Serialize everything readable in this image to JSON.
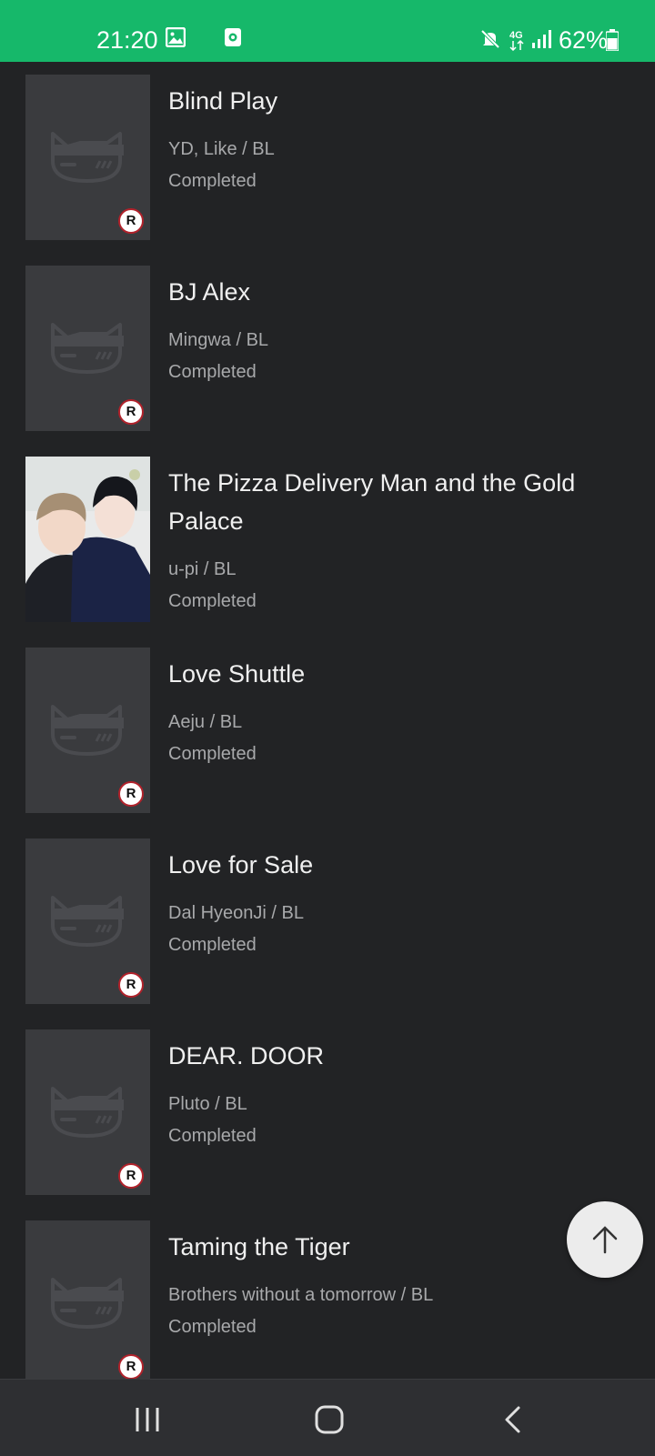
{
  "status_bar": {
    "time": "21:20",
    "battery_percent": "62%",
    "network": "4G",
    "icons": [
      "gallery-icon",
      "app-notification-icon",
      "mute-icon",
      "network-4g-icon",
      "signal-icon",
      "battery-icon"
    ]
  },
  "list": {
    "items": [
      {
        "title": "Blind Play",
        "author_genre": "YD, Like / BL",
        "status": "Completed",
        "cover": "placeholder",
        "rating_badge": "R"
      },
      {
        "title": "BJ Alex",
        "author_genre": "Mingwa / BL",
        "status": "Completed",
        "cover": "placeholder",
        "rating_badge": "R"
      },
      {
        "title": "The Pizza Delivery Man and the Gold Palace",
        "author_genre": "u-pi / BL",
        "status": "Completed",
        "cover": "artwork"
      },
      {
        "title": "Love Shuttle",
        "author_genre": "Aeju / BL",
        "status": "Completed",
        "cover": "placeholder",
        "rating_badge": "R"
      },
      {
        "title": "Love for Sale",
        "author_genre": "Dal HyeonJi / BL",
        "status": "Completed",
        "cover": "placeholder",
        "rating_badge": "R"
      },
      {
        "title": "DEAR. DOOR",
        "author_genre": "Pluto / BL",
        "status": "Completed",
        "cover": "placeholder",
        "rating_badge": "R"
      },
      {
        "title": "Taming the Tiger",
        "author_genre": "Brothers without a tomorrow / BL",
        "status": "Completed",
        "cover": "placeholder",
        "rating_badge": "R"
      }
    ]
  },
  "scroll_top_button": {
    "icon": "arrow-up-icon"
  },
  "nav_bar": {
    "icons": [
      "recent-apps-icon",
      "home-icon",
      "back-icon"
    ]
  },
  "colors": {
    "status_bar": "#16b86a",
    "background": "#222325",
    "thumb_placeholder": "#3a3b3e",
    "badge_border": "#b0212a"
  }
}
